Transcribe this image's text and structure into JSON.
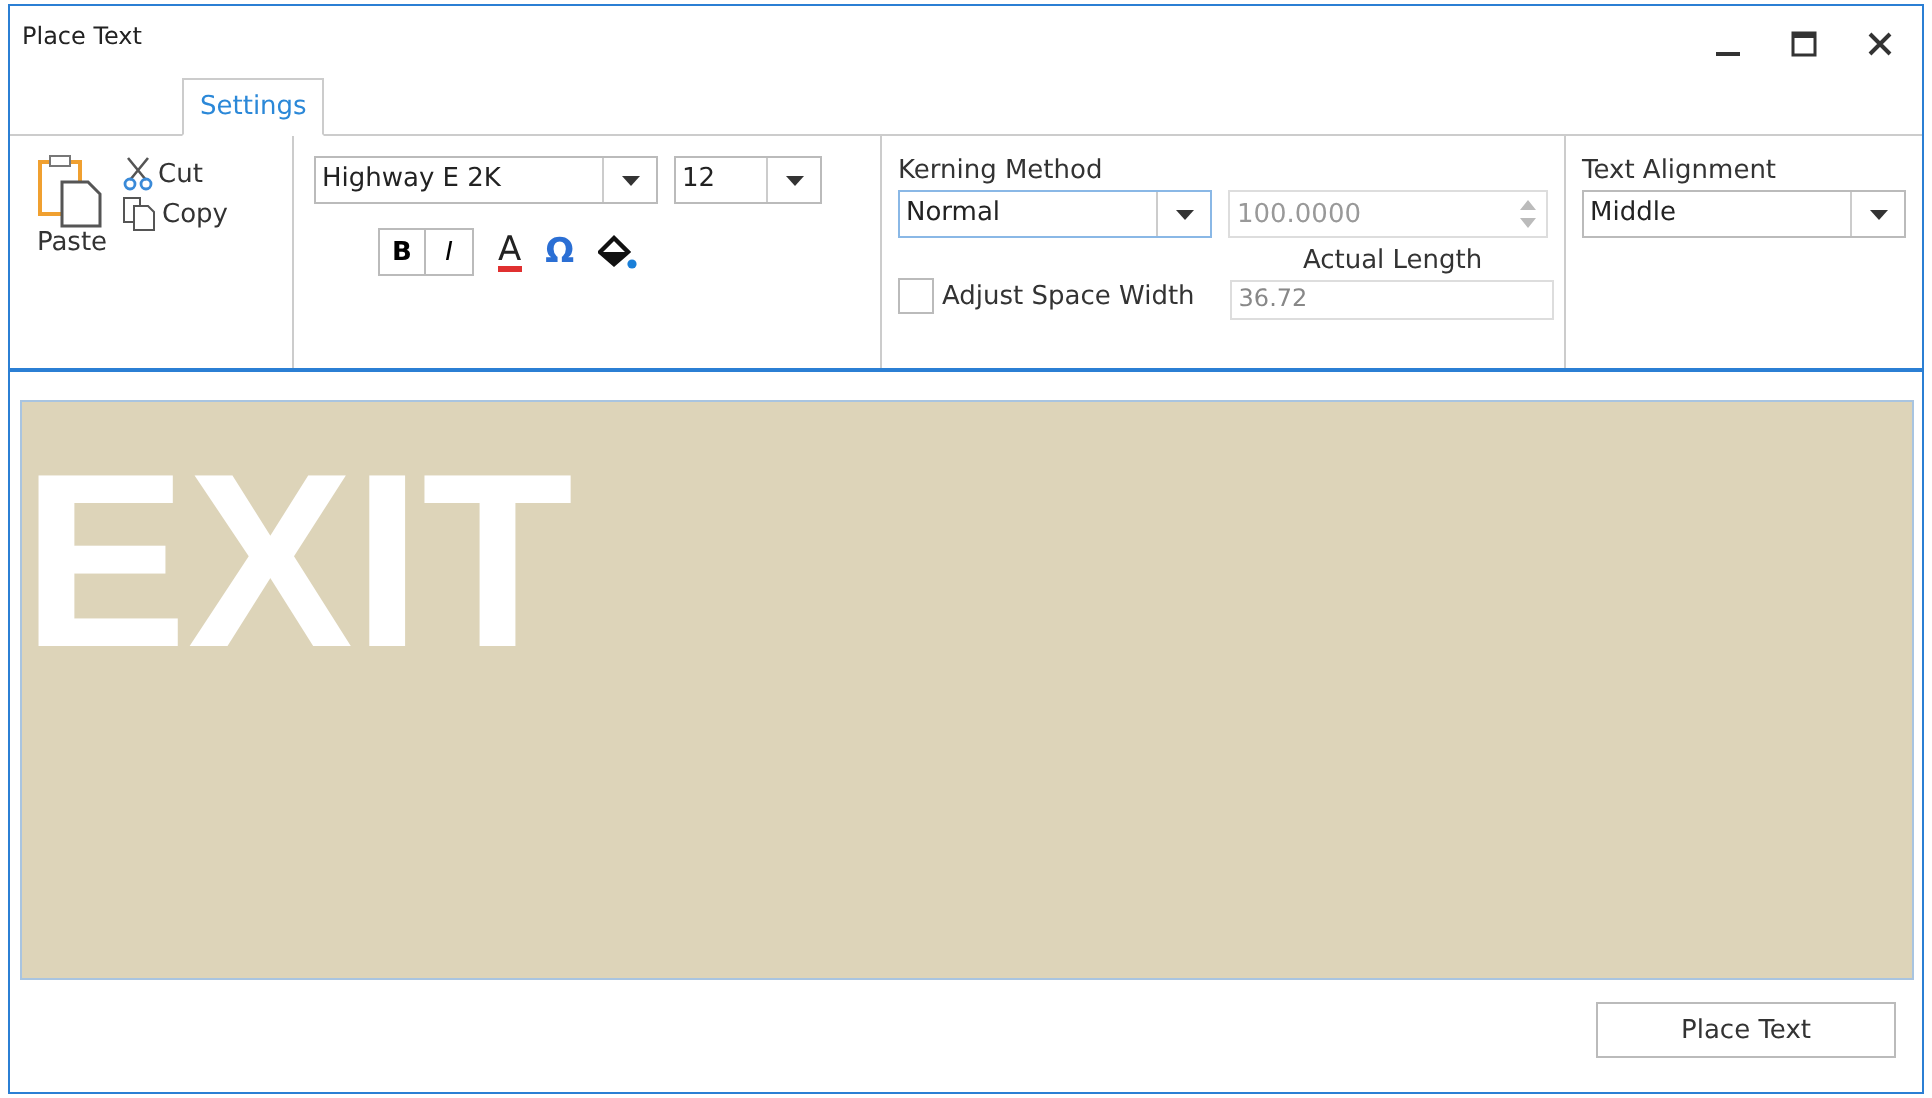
{
  "window": {
    "title": "Place Text"
  },
  "tabs": [
    {
      "label": "Settings",
      "selected": true
    }
  ],
  "clipboard": {
    "paste": "Paste",
    "cut": "Cut",
    "copy": "Copy"
  },
  "font": {
    "family": "Highway E 2K",
    "size": "12",
    "bold": "B",
    "italic": "I",
    "color_glyph": "A",
    "symbol_glyph": "Ω"
  },
  "kerning": {
    "label": "Kerning Method",
    "method": "Normal",
    "spacing": "100.0000",
    "spacing_disabled": true,
    "actual_length_label": "Actual Length",
    "actual_length": "36.72",
    "adjust_space_width": {
      "label": "Adjust Space Width",
      "checked": false
    }
  },
  "alignment": {
    "label": "Text Alignment",
    "value": "Middle"
  },
  "preview": {
    "text": "EXIT"
  },
  "buttons": [
    "Place Text"
  ]
}
